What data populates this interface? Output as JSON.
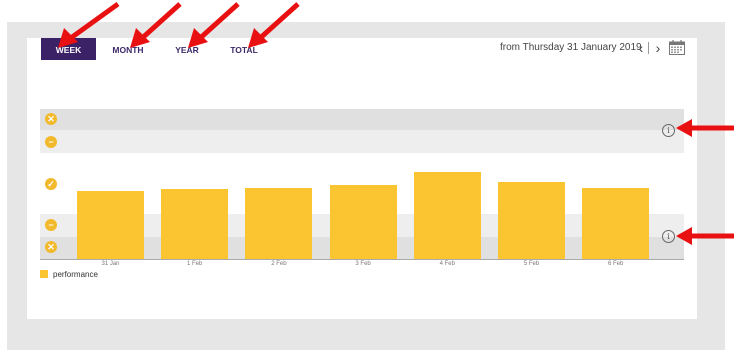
{
  "tabs": [
    {
      "label": "WEEK",
      "active": true
    },
    {
      "label": "MONTH",
      "active": false
    },
    {
      "label": "YEAR",
      "active": false
    },
    {
      "label": "TOTAL",
      "active": false
    }
  ],
  "header": {
    "date_range": "from Thursday 31 January 2019",
    "prev_label": "‹",
    "next_label": "›"
  },
  "chart_data": {
    "type": "bar",
    "categories": [
      "31 Jan",
      "1 Feb",
      "2 Feb",
      "3 Feb",
      "4 Feb",
      "5 Feb",
      "6 Feb"
    ],
    "series": [
      {
        "name": "performance",
        "values": [
          68,
          70,
          71,
          74,
          87,
          77,
          71
        ]
      }
    ],
    "ylim": [
      0,
      100
    ],
    "legend": "bottom-left",
    "colors": {
      "bar": "#fbc531"
    }
  },
  "status_icons": [
    "cancel-icon",
    "minus-icon",
    "check-icon",
    "minus-icon",
    "cancel-icon"
  ],
  "colors": {
    "accent": "#3b2166",
    "status": "#f2b92c",
    "annotation_arrow": "#e81010"
  }
}
